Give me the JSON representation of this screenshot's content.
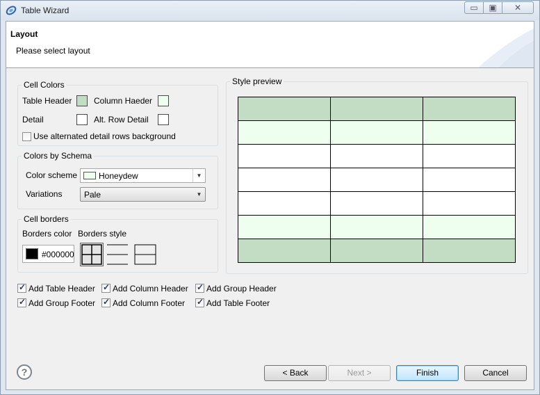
{
  "window": {
    "title": "Table Wizard",
    "min_glyph": "▭",
    "max_glyph": "▣",
    "close_glyph": "✕"
  },
  "header": {
    "title": "Layout",
    "description": "Please select layout"
  },
  "cell_colors": {
    "legend": "Cell Colors",
    "table_header_label": "Table Header",
    "column_header_label": "Column Haeder",
    "detail_label": "Detail",
    "alt_row_detail_label": "Alt. Row Detail",
    "use_alt_label": "Use alternated detail rows background",
    "colors": {
      "table_header": "#c3dcc4",
      "column_header": "#efffef",
      "detail": "#ffffff",
      "alt_row_detail": "#ffffff"
    }
  },
  "schema": {
    "legend": "Colors by Schema",
    "color_scheme_label": "Color scheme",
    "color_scheme_value": "Honeydew",
    "color_scheme_swatch": "#efffef",
    "variations_label": "Variations",
    "variations_value": "Pale"
  },
  "borders": {
    "legend": "Cell borders",
    "color_label": "Borders color",
    "style_label": "Borders style",
    "color_value": "#000000"
  },
  "preview": {
    "legend": "Style preview",
    "colors": {
      "header": "#c3dcc4",
      "alt": "#efffef",
      "detail": "#ffffff"
    }
  },
  "options": [
    {
      "label": "Add Table Header",
      "checked": true
    },
    {
      "label": "Add Column Header",
      "checked": true
    },
    {
      "label": "Add Group Header",
      "checked": true
    },
    {
      "label": "Add Group Footer",
      "checked": true
    },
    {
      "label": "Add Column Footer",
      "checked": true
    },
    {
      "label": "Add Table Footer",
      "checked": true
    }
  ],
  "buttons": {
    "help": "?",
    "back": "< Back",
    "next": "Next >",
    "finish": "Finish",
    "cancel": "Cancel"
  }
}
